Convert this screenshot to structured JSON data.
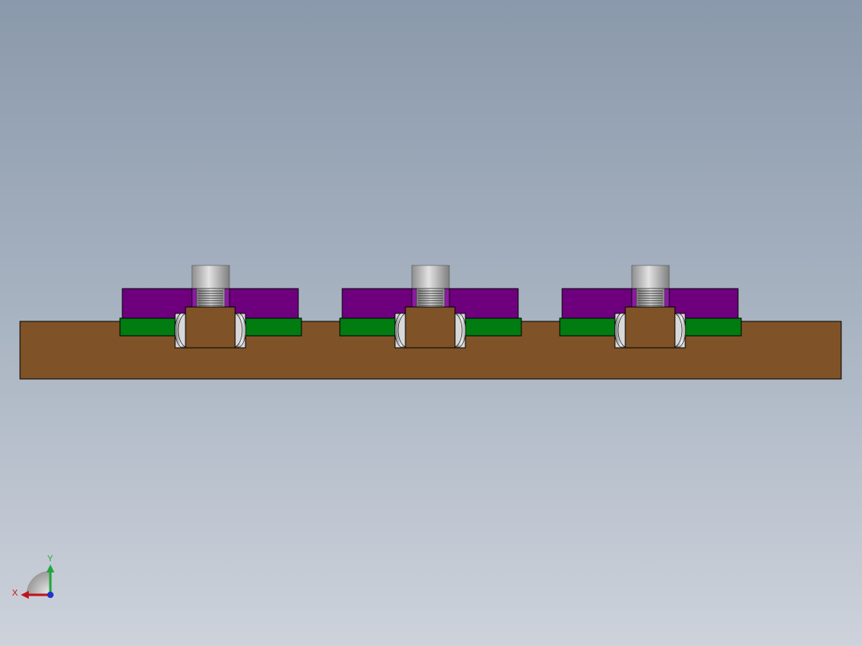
{
  "viewport": {
    "background_top": "#8a99ab",
    "background_bottom": "#cdd2db"
  },
  "model": {
    "base_color": "#7f5327",
    "plate_color": "#6e007e",
    "strip_color": "#007c11",
    "cylinder_color": "#c9c9c9",
    "outline_color": "#000000",
    "units": 3
  },
  "triad": {
    "x_label": "X",
    "y_label": "Y",
    "x_color": "#c0141b",
    "y_color": "#21a63a",
    "z_color": "#1e35c8"
  }
}
